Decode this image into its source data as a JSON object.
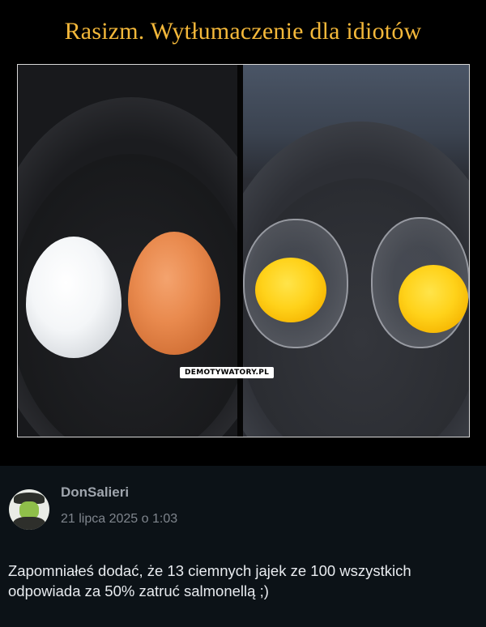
{
  "poster": {
    "title": "Rasizm. Wytłumaczenie dla idiotów",
    "title_color": "#f4b83a",
    "watermark": "DEMOTYWATORY.PL"
  },
  "comment": {
    "username": "DonSalieri",
    "date": "21 lipca 2025 o 1:03",
    "text": "Zapomniałeś dodać, że 13 ciemnych jajek ze 100 wszystkich odpowiada za 50% zatruć salmonellą ;)"
  }
}
